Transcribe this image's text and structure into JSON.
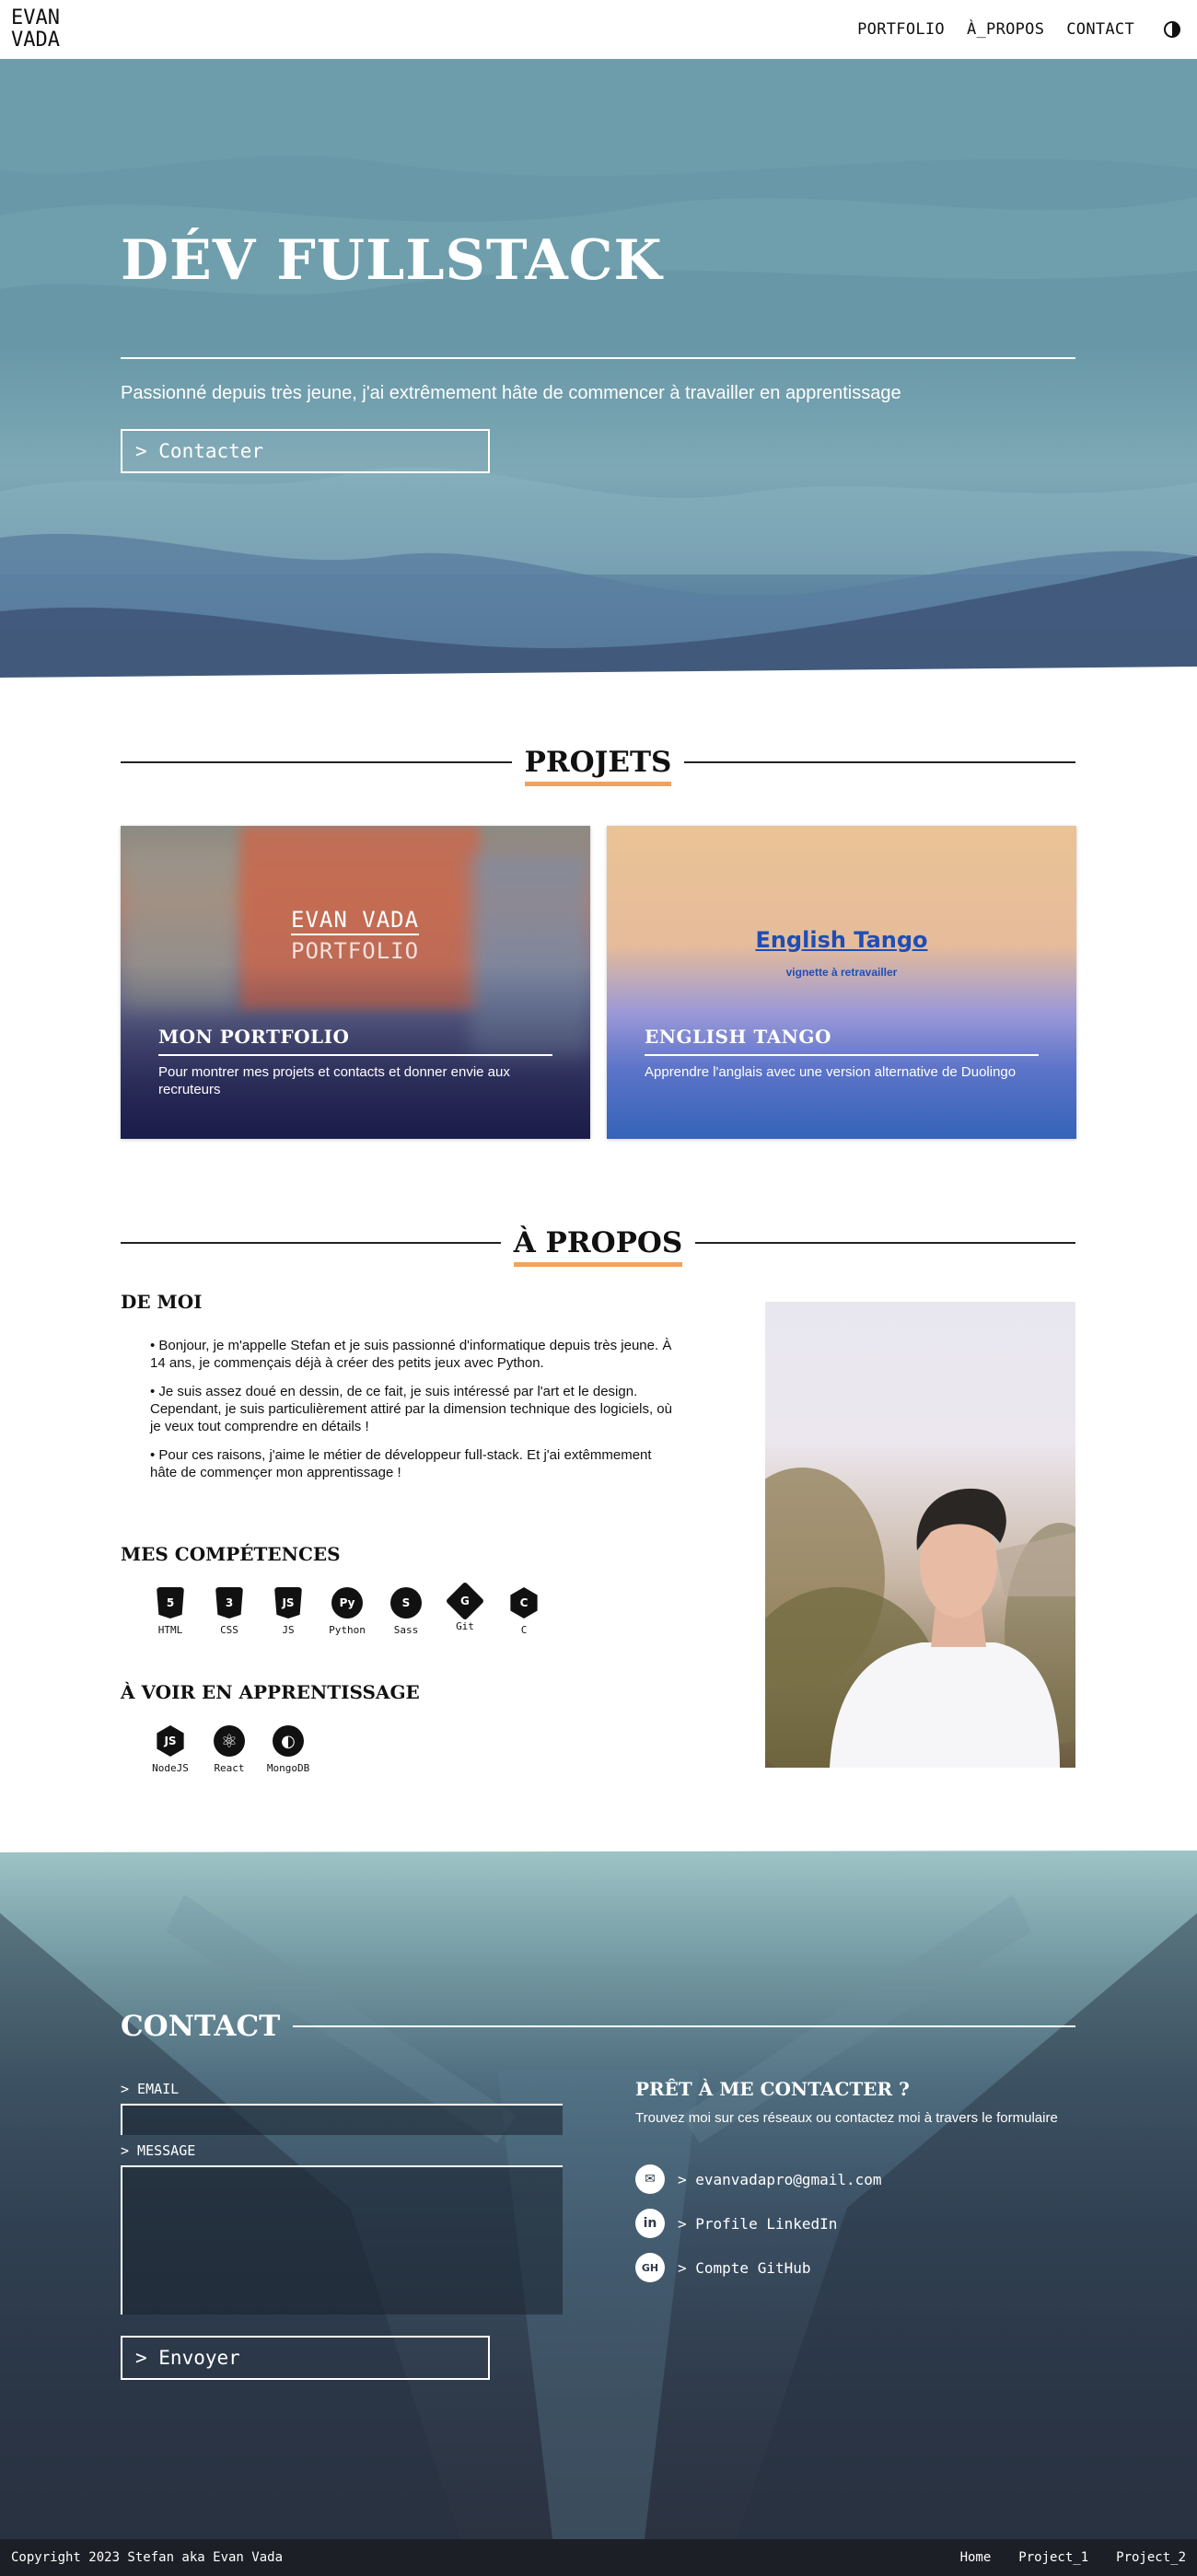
{
  "header": {
    "logo_line1": "EVAN",
    "logo_line2": "VADA",
    "nav": [
      "PORTFOLIO",
      "À_PROPOS",
      "CONTACT"
    ],
    "theme_icon": "contrast-icon"
  },
  "hero": {
    "title": "DÉV FULLSTACK",
    "subtitle": "Passionné depuis très jeune, j'ai extrêmement hâte de commencer à travailler en apprentissage",
    "button": "> Contacter"
  },
  "projects": {
    "title": "PROJETS",
    "cards": [
      {
        "brand_line1": "EVAN VADA",
        "brand_line2": "PORTFOLIO",
        "title": "MON PORTFOLIO",
        "description": "Pour montrer mes projets et contacts et donner envie aux recruteurs"
      },
      {
        "thumb_title": "English Tango",
        "thumb_sub": "vignette à retravailler",
        "title": "ENGLISH TANGO",
        "description": "Apprendre l'anglais avec une version alternative de Duolingo"
      }
    ]
  },
  "about": {
    "title": "À PROPOS",
    "me_heading": "DE MOI",
    "paragraphs": [
      "• Bonjour, je m'appelle Stefan et je suis passionné d'informatique depuis très jeune. À 14 ans, je commençais déjà à créer des petits jeux avec Python.",
      "• Je suis assez doué en dessin, de ce fait, je suis intéressé par l'art et le design. Cependant, je suis particulièrement attiré par la dimension technique des logiciels, où je veux tout comprendre en détails !",
      "• Pour ces raisons, j'aime le métier de développeur full-stack. Et j'ai extêmmement hâte de commençer mon apprentissage !"
    ],
    "skills_heading": "MES COMPÉTENCES",
    "skills": [
      {
        "label": "HTML",
        "glyph": "5",
        "icon": "html5-icon"
      },
      {
        "label": "CSS",
        "glyph": "3",
        "icon": "css3-icon"
      },
      {
        "label": "JS",
        "glyph": "JS",
        "icon": "javascript-icon"
      },
      {
        "label": "Python",
        "glyph": "Py",
        "icon": "python-icon"
      },
      {
        "label": "Sass",
        "glyph": "S",
        "icon": "sass-icon"
      },
      {
        "label": "Git",
        "glyph": "G",
        "icon": "git-icon"
      },
      {
        "label": "C",
        "glyph": "C",
        "icon": "c-icon"
      }
    ],
    "learning_heading": "À VOIR EN APPRENTISSAGE",
    "learning": [
      {
        "label": "NodeJS",
        "glyph": "JS",
        "icon": "nodejs-icon"
      },
      {
        "label": "React",
        "glyph": "⚛",
        "icon": "react-icon"
      },
      {
        "label": "MongoDB",
        "glyph": "◐",
        "icon": "mongodb-icon"
      }
    ]
  },
  "contact": {
    "title": "CONTACT",
    "email_label": "> EMAIL",
    "message_label": "> MESSAGE",
    "send_button": "> Envoyer",
    "ready_title": "PRÊT À ME CONTACTER ?",
    "ready_sub": "Trouvez moi sur ces réseaux ou contactez moi à travers le formulaire",
    "links": [
      {
        "label": "> evanvadapro@gmail.com",
        "icon": "mail-icon",
        "glyph": "✉"
      },
      {
        "label": "> Profile LinkedIn",
        "icon": "linkedin-icon",
        "glyph": "in"
      },
      {
        "label": "> Compte GitHub",
        "icon": "github-icon",
        "glyph": "GH"
      }
    ]
  },
  "footer": {
    "copyright": "Copyright 2023 Stefan aka Evan Vada",
    "links": [
      "Home",
      "Project_1",
      "Project_2"
    ]
  }
}
